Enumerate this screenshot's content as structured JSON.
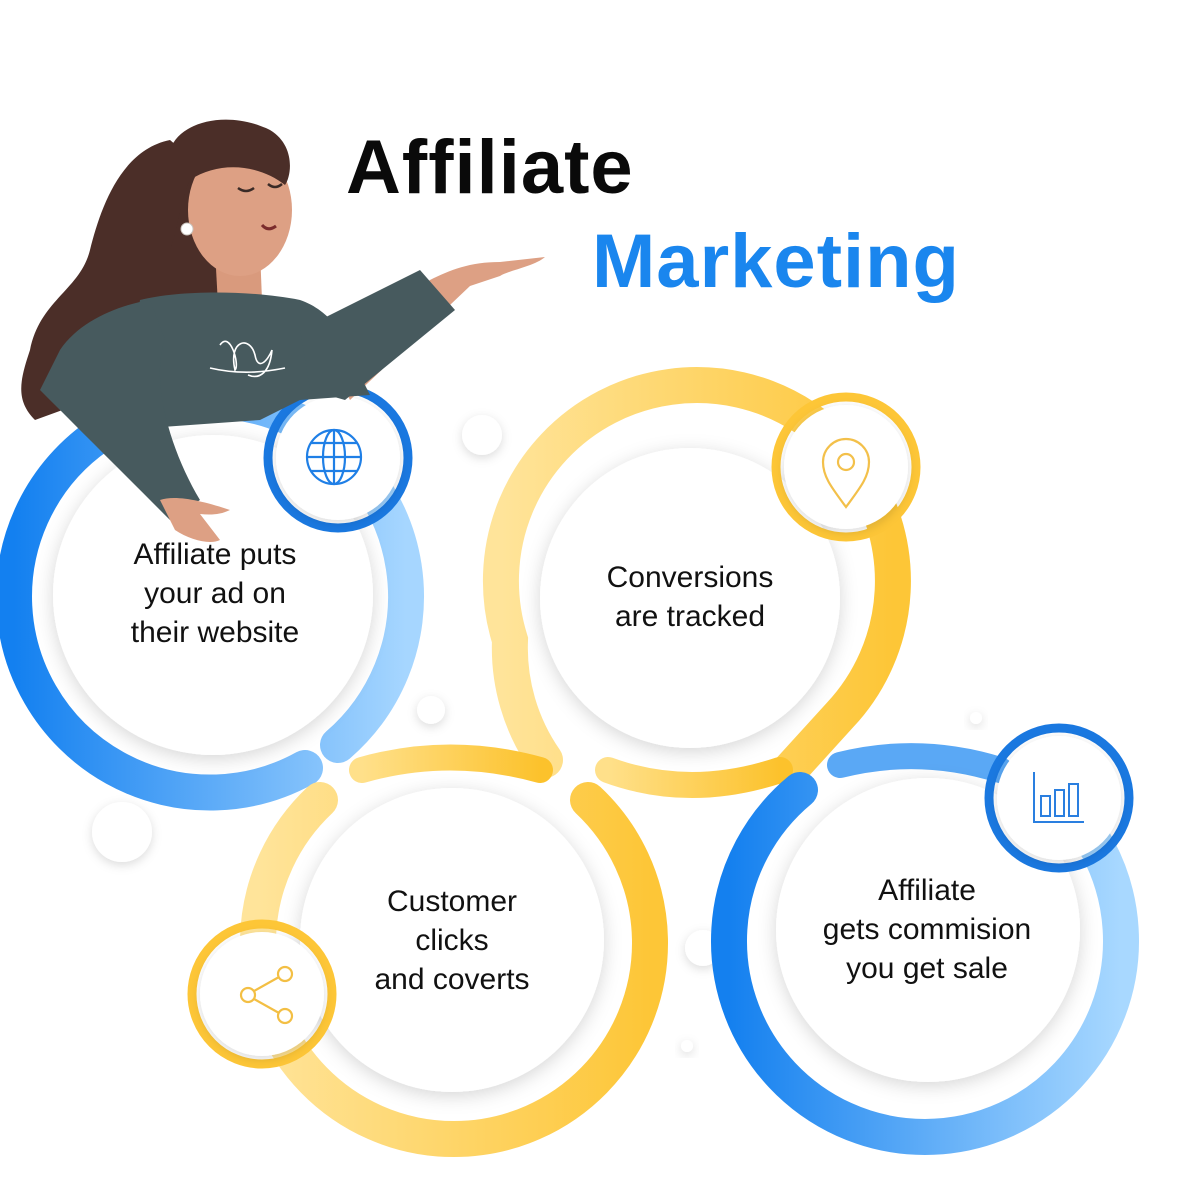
{
  "title": {
    "line1": "Affiliate",
    "line2": "Marketing"
  },
  "colors": {
    "blue": "#1a86ee",
    "yellow": "#fdc83a",
    "text": "#111111"
  },
  "steps": [
    {
      "lines": [
        "Affiliate puts",
        "your ad on",
        "their website"
      ],
      "icon": "globe-icon",
      "color": "blue"
    },
    {
      "lines": [
        "Conversions",
        "are tracked"
      ],
      "icon": "location-pin-icon",
      "color": "yellow"
    },
    {
      "lines": [
        "Customer",
        "clicks",
        "and coverts"
      ],
      "icon": "share-icon",
      "color": "yellow"
    },
    {
      "lines": [
        "Affiliate",
        "gets commision",
        "you get sale"
      ],
      "icon": "bar-chart-icon",
      "color": "blue"
    }
  ]
}
